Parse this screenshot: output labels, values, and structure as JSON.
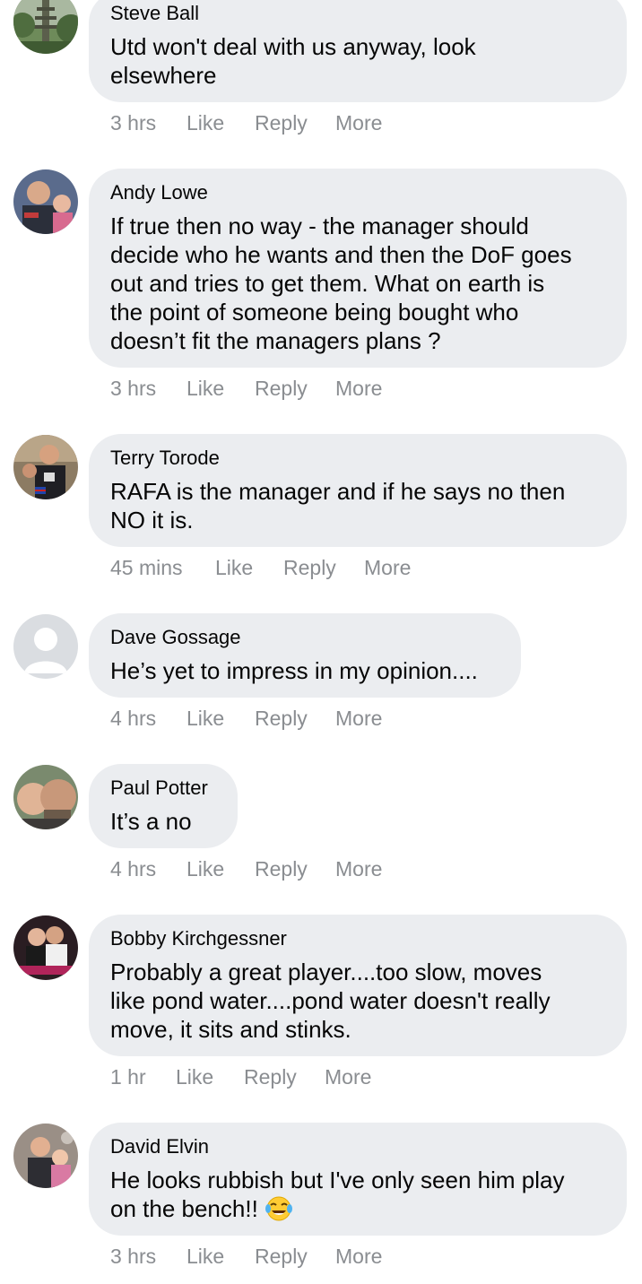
{
  "comments": [
    {
      "author": "Steve Ball",
      "lines": [
        "Utd won't deal with us anyway, look",
        "elsewhere"
      ],
      "time": "3 hrs",
      "avatar": "pagoda-tree-photo"
    },
    {
      "author": "Andy Lowe",
      "lines": [
        "If true then no way - the manager should",
        "decide who he wants and then the DoF goes",
        "out and tries to get them. What on earth is",
        "the point of someone being bought who",
        "doesn’t fit the managers plans ?"
      ],
      "time": "3 hrs",
      "avatar": "man-and-child-photo"
    },
    {
      "author": "Terry Torode",
      "lines": [
        "RAFA is the manager and if he says no then",
        "NO it is."
      ],
      "time": "45 mins",
      "avatar": "man-in-black-tshirt-photo"
    },
    {
      "author": "Dave Gossage",
      "lines": [
        "He’s yet to impress in my opinion...."
      ],
      "time": "4 hrs",
      "avatar": "default-profile-silhouette"
    },
    {
      "author": "Paul Potter",
      "lines": [
        "It’s a no"
      ],
      "time": "4 hrs",
      "avatar": "man-and-child-selfie-photo"
    },
    {
      "author": "Bobby Kirchgessner",
      "lines": [
        "Probably a great player....too slow, moves",
        "like pond water....pond water doesn't really",
        "move, it sits and stinks."
      ],
      "time": "1 hr",
      "avatar": "couple-with-love-you-text-photo"
    },
    {
      "author": "David Elvin",
      "lines": [
        "He looks rubbish but I've only seen him play",
        "on the bench!!"
      ],
      "time": "3 hrs",
      "avatar": "man-with-children-photo",
      "emoji": "face-with-tears-of-joy"
    }
  ],
  "actions": {
    "like": "Like",
    "reply": "Reply",
    "more": "More"
  },
  "colors": {
    "bubble": "#ebedf0",
    "meta": "#8a8d91",
    "text": "#050505"
  }
}
